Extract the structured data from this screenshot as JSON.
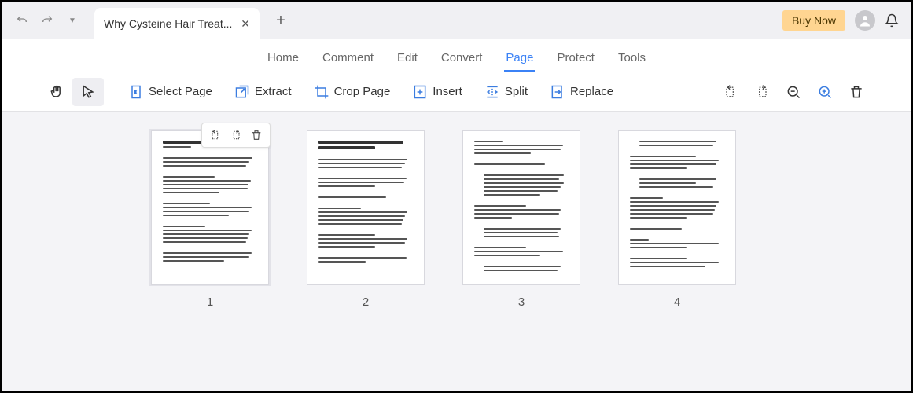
{
  "titlebar": {
    "tab_title": "Why Cysteine Hair Treat...",
    "buy_now": "Buy Now"
  },
  "menu": {
    "items": [
      {
        "label": "Home",
        "active": false
      },
      {
        "label": "Comment",
        "active": false
      },
      {
        "label": "Edit",
        "active": false
      },
      {
        "label": "Convert",
        "active": false
      },
      {
        "label": "Page",
        "active": true
      },
      {
        "label": "Protect",
        "active": false
      },
      {
        "label": "Tools",
        "active": false
      }
    ]
  },
  "toolbar": {
    "select_page": "Select Page",
    "extract": "Extract",
    "crop_page": "Crop Page",
    "insert": "Insert",
    "split": "Split",
    "replace": "Replace"
  },
  "pages": {
    "thumbnails": [
      {
        "num": "1",
        "selected": true
      },
      {
        "num": "2",
        "selected": false
      },
      {
        "num": "3",
        "selected": false
      },
      {
        "num": "4",
        "selected": false
      }
    ]
  }
}
